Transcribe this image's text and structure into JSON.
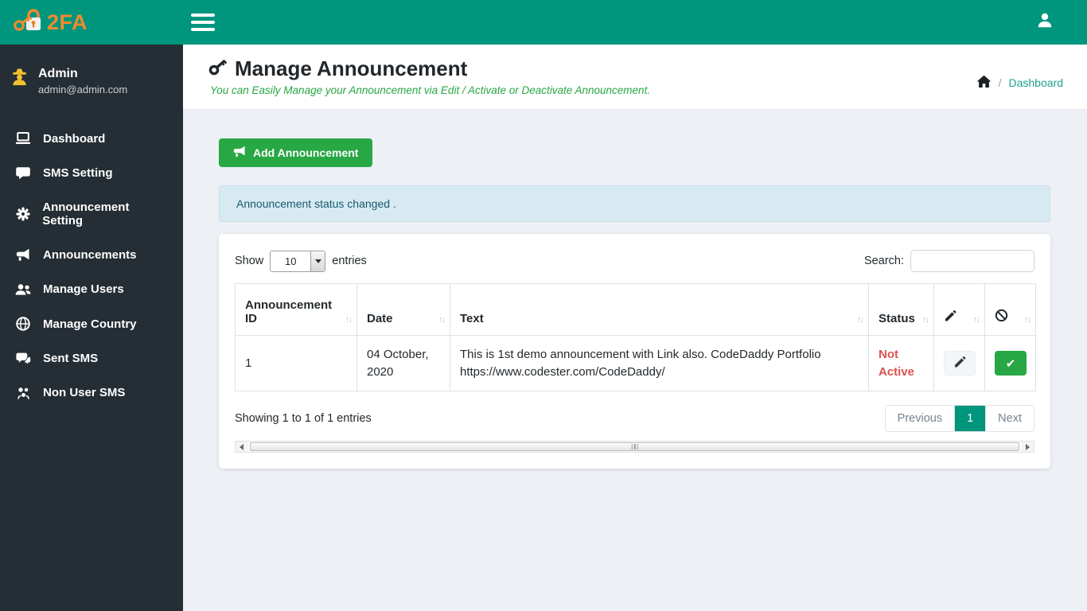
{
  "brand": {
    "name": "2FA"
  },
  "sidebar": {
    "user": {
      "name": "Admin",
      "email": "admin@admin.com"
    },
    "items": [
      {
        "label": "Dashboard",
        "icon": "laptop-icon"
      },
      {
        "label": "SMS Setting",
        "icon": "comment-icon"
      },
      {
        "label": "Announcement Setting",
        "icon": "gear-icon"
      },
      {
        "label": "Announcements",
        "icon": "bullhorn-icon"
      },
      {
        "label": "Manage Users",
        "icon": "users-icon"
      },
      {
        "label": "Manage Country",
        "icon": "globe-icon"
      },
      {
        "label": "Sent SMS",
        "icon": "comments-icon"
      },
      {
        "label": "Non User SMS",
        "icon": "user-group-icon"
      }
    ]
  },
  "page": {
    "title": "Manage Announcement",
    "subtitle": "You can Easily Manage your Announcement via Edit / Activate or Deactivate Announcement.",
    "breadcrumb": {
      "separator": "/",
      "current": "Dashboard"
    }
  },
  "actions": {
    "add_button": "Add Announcement"
  },
  "alert": {
    "message": "Announcement status changed ."
  },
  "table": {
    "show_label": "Show",
    "page_length": "10",
    "entries_label": "entries",
    "search_label": "Search:",
    "search_value": "",
    "headers": {
      "id": "Announcement ID",
      "date": "Date",
      "text": "Text",
      "status": "Status"
    },
    "rows": [
      {
        "id": "1",
        "date": "04 October, 2020",
        "text": "This is 1st demo announcement with Link also. CodeDaddy Portfolio https://www.codester.com/CodeDaddy/",
        "status": "Not Active"
      }
    ],
    "info": "Showing 1 to 1 of 1 entries",
    "pagination": {
      "previous": "Previous",
      "page": "1",
      "next": "Next"
    }
  },
  "icons": {
    "sort": "↑↓",
    "check": "✔"
  },
  "colors": {
    "teal": "#00967e",
    "sidebar_bg": "#252e34",
    "green": "#28a745",
    "danger_text": "#d9534f",
    "alert_bg": "#d7eaf2",
    "alert_text": "#175a6e",
    "brand_orange": "#ef8b2e",
    "spy_yellow": "#f2c12e"
  }
}
